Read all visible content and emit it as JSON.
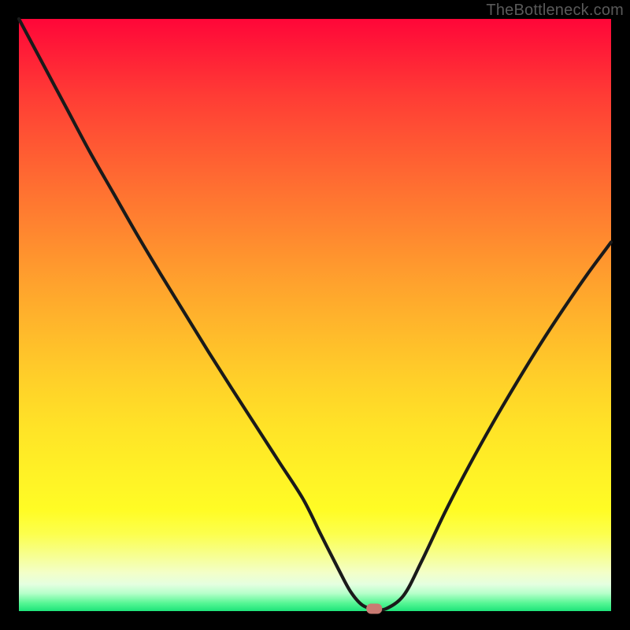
{
  "attribution": "TheBottleneck.com",
  "colors": {
    "frame": "#000000",
    "marker_fill": "#c97a72",
    "curve_stroke": "#1a1a1a"
  },
  "chart_data": {
    "type": "line",
    "title": "",
    "xlabel": "",
    "ylabel": "",
    "xlim": [
      0,
      100
    ],
    "ylim": [
      0,
      100
    ],
    "grid": false,
    "legend": false,
    "series": [
      {
        "name": "bottleneck-curve",
        "x": [
          0,
          4,
          8,
          12,
          16,
          20,
          24,
          28,
          32,
          36,
          40,
          44,
          48,
          51,
          54,
          56,
          58,
          60,
          62,
          65,
          68,
          72,
          76,
          80,
          84,
          88,
          92,
          96,
          100
        ],
        "values": [
          100,
          92.5,
          85,
          77.5,
          70.5,
          63.5,
          56.8,
          50.3,
          43.8,
          37.5,
          31.3,
          25.1,
          18.9,
          12.9,
          7.0,
          3.3,
          1.0,
          0.4,
          0.4,
          2.7,
          8.4,
          16.8,
          24.5,
          31.7,
          38.5,
          45.0,
          51.1,
          56.9,
          62.3
        ]
      }
    ],
    "annotations": [
      {
        "name": "valley-point",
        "x": 60,
        "y": 0.4
      }
    ]
  }
}
